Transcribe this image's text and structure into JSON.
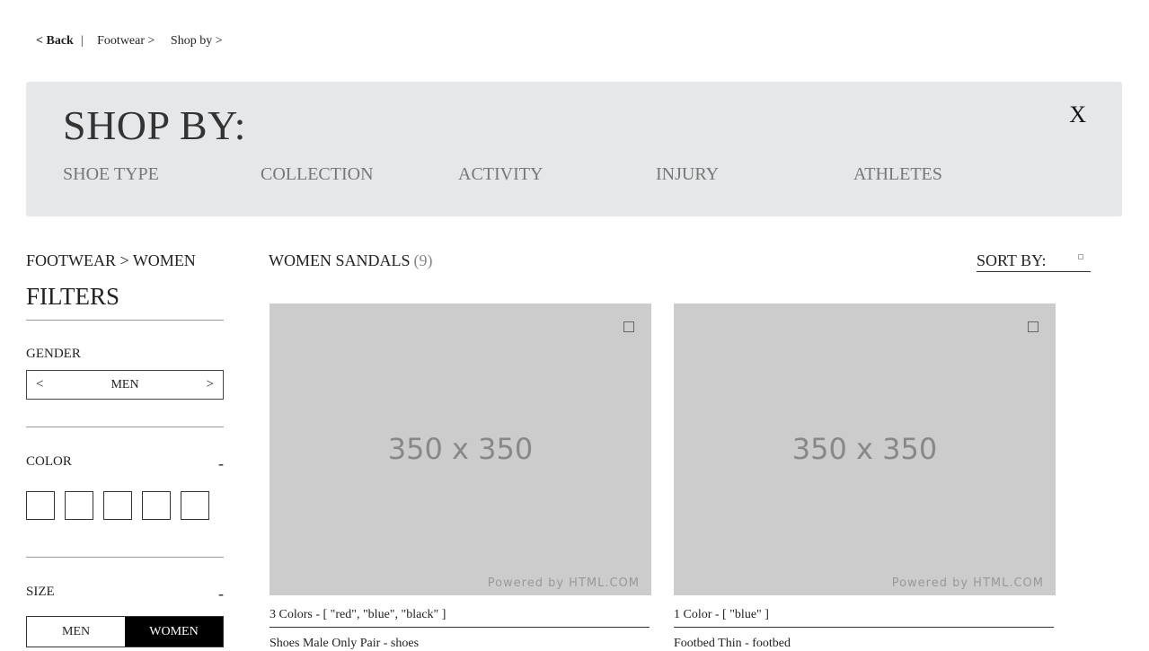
{
  "breadcrumb": {
    "back": "< Back",
    "separator": "|",
    "items": [
      "Footwear >",
      "Shop by >"
    ]
  },
  "shop_by": {
    "title": "SHOP BY:",
    "close": "X",
    "tabs": [
      "SHOE TYPE",
      "COLLECTION",
      "ACTIVITY",
      "INJURY",
      "ATHLETES"
    ]
  },
  "sidebar": {
    "crumb": "FOOTWEAR >  WOMEN",
    "filters_title": "FILTERS",
    "gender": {
      "label": "GENDER",
      "prev": "<",
      "value": "MEN",
      "next": ">"
    },
    "color": {
      "label": "COLOR",
      "toggle": "-"
    },
    "size": {
      "label": "SIZE",
      "toggle": "-",
      "options": [
        "MEN",
        "WOMEN"
      ],
      "selected": "WOMEN"
    }
  },
  "results": {
    "title": "WOMEN SANDALS",
    "count": "(9)"
  },
  "sort": {
    "label": "SORT BY:"
  },
  "products": [
    {
      "placeholder": "350 x 350",
      "powered": "Powered by HTML.COM",
      "colors": "3 Colors - [ \"red\", \"blue\", \"black\" ]",
      "name": "Shoes Male Only Pair - shoes"
    },
    {
      "placeholder": "350 x 350",
      "powered": "Powered by HTML.COM",
      "colors": "1 Color - [ \"blue\" ]",
      "name": "Footbed Thin - footbed"
    }
  ]
}
